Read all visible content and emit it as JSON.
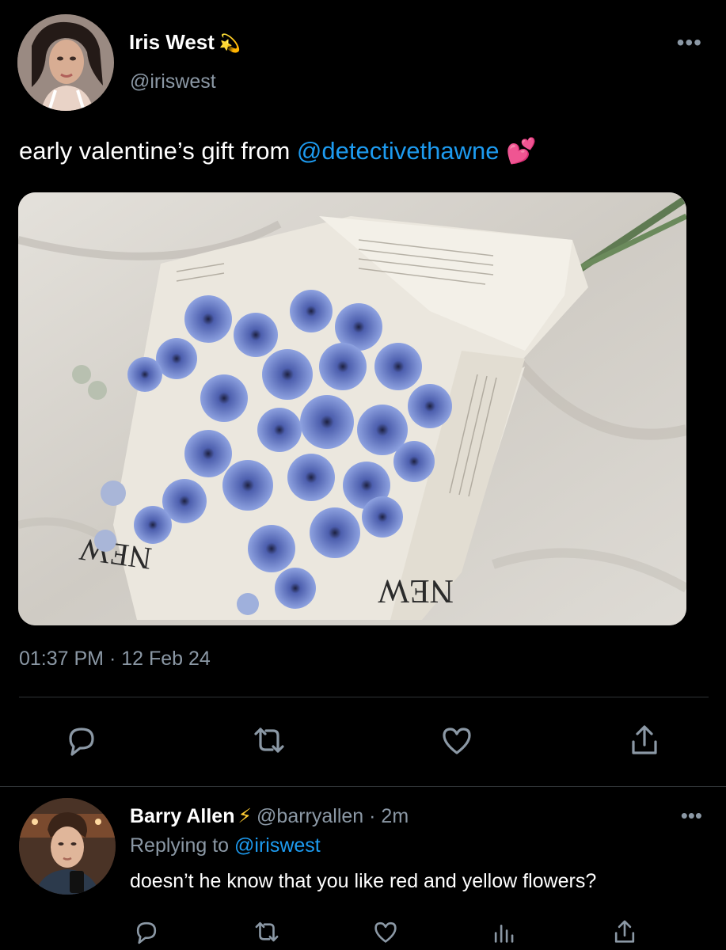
{
  "tweet": {
    "author_name": "Iris West",
    "author_emoji": "💫",
    "author_handle": "@iriswest",
    "more_label": "•••",
    "text_prefix": "early valentine’s gift from ",
    "mention": "@detectivethawne",
    "text_emoji": "💕",
    "timestamp": "01:37 PM · 12 Feb 24",
    "actions": [
      "reply-icon",
      "retweet-icon",
      "like-icon",
      "share-icon"
    ]
  },
  "reply": {
    "author_name": "Barry Allen",
    "author_emoji": "⚡",
    "author_handle": "@barryallen",
    "time": "· 2m",
    "replying_label": "Replying to",
    "replying_to": "@iriswest",
    "text": "doesn’t he know that you like red and yellow flowers?",
    "more_label": "•••",
    "actions": [
      "reply-icon",
      "retweet-icon",
      "like-icon",
      "analytics-icon",
      "share-icon"
    ]
  },
  "colors": {
    "background": "#000000",
    "primary_text": "#ffffff",
    "secondary_text": "#8b98a5",
    "link": "#1d9bf0",
    "divider": "#2f3336"
  }
}
